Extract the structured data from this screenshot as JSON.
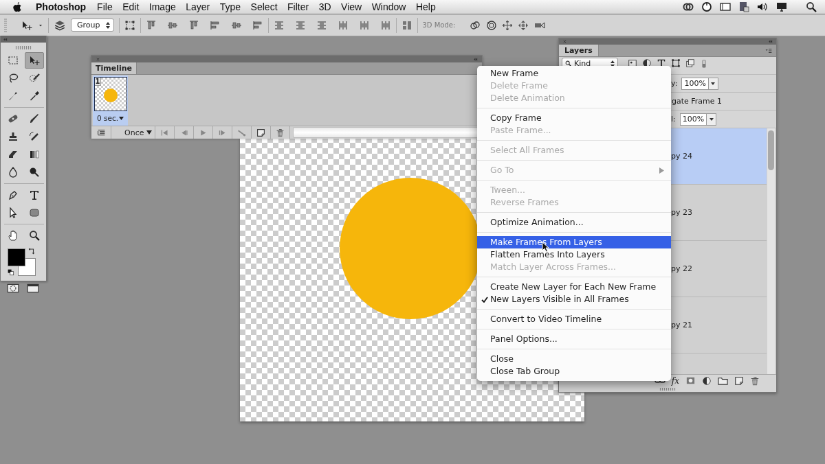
{
  "menubar": {
    "app": "Photoshop",
    "items": [
      "File",
      "Edit",
      "Image",
      "Layer",
      "Type",
      "Select",
      "Filter",
      "3D",
      "View",
      "Window",
      "Help"
    ]
  },
  "options_bar": {
    "auto_select": "Group",
    "mode_label": "3D Mode:"
  },
  "tools": [
    {
      "selected": false
    },
    {
      "selected": true
    },
    {
      "selected": false
    },
    {
      "selected": false
    },
    {
      "selected": false
    },
    {
      "selected": false
    },
    {
      "selected": false
    },
    {
      "selected": false
    },
    {
      "selected": false
    },
    {
      "selected": false
    },
    {
      "selected": false
    },
    {
      "selected": false
    },
    {
      "selected": false
    },
    {
      "selected": false
    },
    {
      "selected": false
    },
    {
      "selected": false
    },
    {
      "selected": false
    },
    {
      "selected": false
    },
    {
      "selected": false
    },
    {
      "selected": false
    }
  ],
  "timeline": {
    "tab": "Timeline",
    "frames": [
      {
        "number": "1",
        "delay": "0 sec.",
        "selected": true
      }
    ],
    "loop": "Once"
  },
  "layers_panel": {
    "tab": "Layers",
    "filter": "Kind",
    "opacity_label": "y:",
    "opacity": "100%",
    "propagate": "gate Frame 1",
    "fill_label": "l:",
    "fill": "100%",
    "effects": "fx",
    "layers": [
      {
        "name": "py 24",
        "selected": true
      },
      {
        "name": "py 23",
        "selected": false
      },
      {
        "name": "py 22",
        "selected": false
      },
      {
        "name": "py 21",
        "selected": false
      }
    ]
  },
  "context_menu": {
    "sections": [
      [
        {
          "label": "New Frame",
          "disabled": false,
          "selected": false,
          "checked": false,
          "submenu": false
        },
        {
          "label": "Delete Frame",
          "disabled": true,
          "selected": false,
          "checked": false,
          "submenu": false
        },
        {
          "label": "Delete Animation",
          "disabled": true,
          "selected": false,
          "checked": false,
          "submenu": false
        }
      ],
      [
        {
          "label": "Copy Frame",
          "disabled": false,
          "selected": false,
          "checked": false,
          "submenu": false
        },
        {
          "label": "Paste Frame...",
          "disabled": true,
          "selected": false,
          "checked": false,
          "submenu": false
        }
      ],
      [
        {
          "label": "Select All Frames",
          "disabled": true,
          "selected": false,
          "checked": false,
          "submenu": false
        }
      ],
      [
        {
          "label": "Go To",
          "disabled": true,
          "selected": false,
          "checked": false,
          "submenu": true
        }
      ],
      [
        {
          "label": "Tween...",
          "disabled": true,
          "selected": false,
          "checked": false,
          "submenu": false
        },
        {
          "label": "Reverse Frames",
          "disabled": true,
          "selected": false,
          "checked": false,
          "submenu": false
        }
      ],
      [
        {
          "label": "Optimize Animation...",
          "disabled": false,
          "selected": false,
          "checked": false,
          "submenu": false
        }
      ],
      [
        {
          "label": "Make Frames From Layers",
          "disabled": false,
          "selected": true,
          "checked": false,
          "submenu": false
        },
        {
          "label": "Flatten Frames Into Layers",
          "disabled": false,
          "selected": false,
          "checked": false,
          "submenu": false
        },
        {
          "label": "Match Layer Across Frames...",
          "disabled": true,
          "selected": false,
          "checked": false,
          "submenu": false
        }
      ],
      [
        {
          "label": "Create New Layer for Each New Frame",
          "disabled": false,
          "selected": false,
          "checked": false,
          "submenu": false
        },
        {
          "label": "New Layers Visible in All Frames",
          "disabled": false,
          "selected": false,
          "checked": true,
          "submenu": false
        }
      ],
      [
        {
          "label": "Convert to Video Timeline",
          "disabled": false,
          "selected": false,
          "checked": false,
          "submenu": false
        }
      ],
      [
        {
          "label": "Panel Options...",
          "disabled": false,
          "selected": false,
          "checked": false,
          "submenu": false
        }
      ],
      [
        {
          "label": "Close",
          "disabled": false,
          "selected": false,
          "checked": false,
          "submenu": false
        },
        {
          "label": "Close Tab Group",
          "disabled": false,
          "selected": false,
          "checked": false,
          "submenu": false
        }
      ]
    ]
  }
}
